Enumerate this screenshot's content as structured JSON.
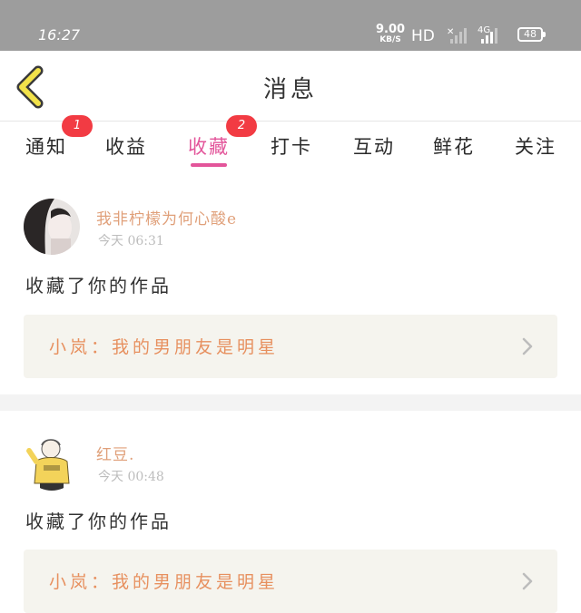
{
  "status_bar": {
    "time": "16:27",
    "net_speed": "9.00",
    "net_speed_unit": "KB/S",
    "hd_label": "HD",
    "signal2_label": "4G",
    "battery": "48"
  },
  "header": {
    "title": "消息",
    "back_icon": "chevron-left-icon"
  },
  "tabs": [
    {
      "label": "通知",
      "badge": "1",
      "active": false
    },
    {
      "label": "收益",
      "badge": "",
      "active": false
    },
    {
      "label": "收藏",
      "badge": "2",
      "active": true
    },
    {
      "label": "打卡",
      "badge": "",
      "active": false
    },
    {
      "label": "互动",
      "badge": "",
      "active": false
    },
    {
      "label": "鲜花",
      "badge": "",
      "active": false
    },
    {
      "label": "关注",
      "badge": "",
      "active": false
    }
  ],
  "messages": [
    {
      "user": "我非柠檬为何心酸e",
      "time": "今天 06:31",
      "action": "收藏了你的作品",
      "work": "小岚：我的男朋友是明星"
    },
    {
      "user": "红豆.",
      "time": "今天 00:48",
      "action": "收藏了你的作品",
      "work": "小岚：我的男朋友是明星"
    }
  ],
  "colors": {
    "accent": "#e3559a",
    "badge": "#f23b43",
    "username": "#e0a07a",
    "work_title": "#e7905f",
    "back_icon": "#f2e24a"
  }
}
